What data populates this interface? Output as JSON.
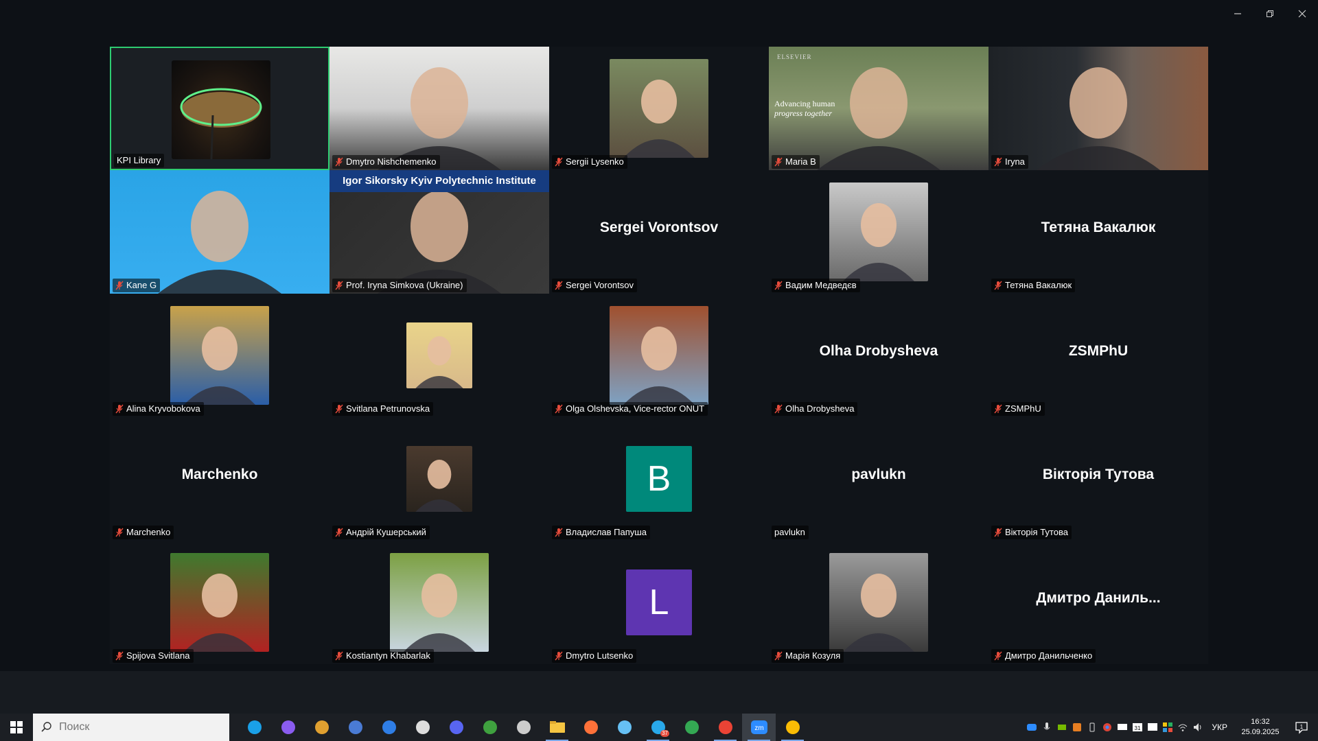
{
  "window": {
    "minimize_symbol": "–",
    "restore_symbol": "❐",
    "close_symbol": "✕"
  },
  "participants": [
    {
      "name": "KPI Library",
      "kind": "video",
      "muted": false,
      "speaking": true
    },
    {
      "name": "Dmytro Nishchemenko",
      "kind": "video",
      "muted": true
    },
    {
      "name": "Sergii Lysenko",
      "kind": "photo",
      "muted": true
    },
    {
      "name": "Maria B",
      "kind": "video",
      "muted": true,
      "overlay_brand": "ELSEVIER",
      "overlay_line1": "Advancing human",
      "overlay_line2": "progress together"
    },
    {
      "name": "Iryna",
      "kind": "video",
      "muted": true
    },
    {
      "name": "Kane G",
      "kind": "video",
      "muted": true
    },
    {
      "name": "Prof. Iryna Simkova (Ukraine)",
      "kind": "video",
      "muted": true,
      "banner": "Igor Sikorsky Kyiv Polytechnic Institute"
    },
    {
      "name": "Sergei Vorontsov",
      "kind": "name",
      "muted": true,
      "display": "Sergei Vorontsov"
    },
    {
      "name": "Вадим Медведєв",
      "kind": "photo",
      "muted": true
    },
    {
      "name": "Тетяна Вакалюк",
      "kind": "name",
      "muted": true,
      "display": "Тетяна Вакалюк"
    },
    {
      "name": "Alina Kryvobokova",
      "kind": "photo",
      "muted": true
    },
    {
      "name": "Svitlana Petrunovska",
      "kind": "photo-small",
      "muted": true
    },
    {
      "name": "Olga Olshevska, Vice-rector ONUT",
      "kind": "photo",
      "muted": true
    },
    {
      "name": "Olha Drobysheva",
      "kind": "name",
      "muted": true,
      "display": "Olha Drobysheva"
    },
    {
      "name": "ZSMPhU",
      "kind": "name",
      "muted": true,
      "display": "ZSMPhU"
    },
    {
      "name": "Marchenko",
      "kind": "name",
      "muted": true,
      "display": "Marchenko"
    },
    {
      "name": "Андрій Кушерський",
      "kind": "photo-small",
      "muted": true
    },
    {
      "name": "Владислав Папуша",
      "kind": "letter",
      "muted": true,
      "letter": "B",
      "color": "#00897b"
    },
    {
      "name": "pavlukn",
      "kind": "name",
      "muted": false,
      "display": "pavlukn"
    },
    {
      "name": "Вікторія Тутова",
      "kind": "name",
      "muted": true,
      "display": "Вікторія Тутова"
    },
    {
      "name": "Spijova Svitlana",
      "kind": "photo",
      "muted": true
    },
    {
      "name": "Kostiantyn Khabarlak",
      "kind": "photo",
      "muted": true
    },
    {
      "name": "Dmytro Lutsenko",
      "kind": "letter",
      "muted": true,
      "letter": "L",
      "color": "#5e35b1"
    },
    {
      "name": "Марія Козуля",
      "kind": "photo",
      "muted": true
    },
    {
      "name": "Дмитро Данильченко",
      "kind": "name",
      "muted": true,
      "display": "Дмитро  Даниль..."
    }
  ],
  "taskbar": {
    "search_placeholder": "Поиск",
    "apps": [
      "edge-icon",
      "copilot-icon",
      "paint-icon",
      "calculator-icon",
      "store-icon",
      "obs-icon",
      "discord-icon",
      "minecraft-icon",
      "steam-alt-icon",
      "file-explorer-icon",
      "firefox-icon",
      "steam-icon",
      "telegram-icon",
      "chrome-icon",
      "chrome-profile-icon",
      "zoom-icon",
      "chrome-alt-icon"
    ],
    "telegram_badge": "37",
    "lang": "УКР",
    "time": "16:32",
    "date": "25.09.2025",
    "notifications": "1",
    "calendar_day": "31"
  },
  "colors": {
    "speaking": "#2ecc71",
    "muted_icon": "#e74c3c",
    "zoom": "#2d8cff"
  }
}
